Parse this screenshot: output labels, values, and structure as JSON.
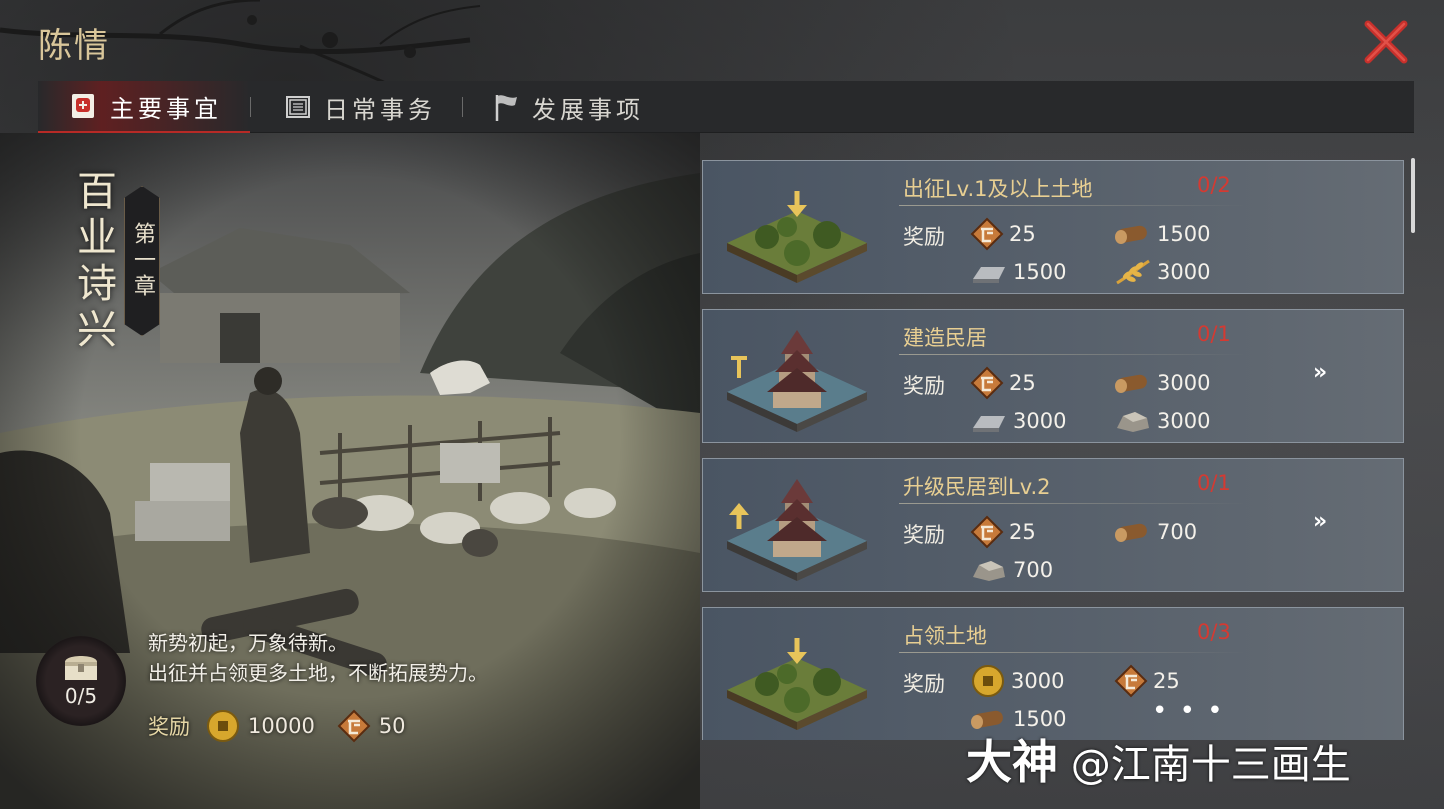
{
  "header": {
    "title": "陈情"
  },
  "tabs": [
    {
      "label": "主要事宜",
      "icon": "scroll-seal-icon",
      "active": true
    },
    {
      "label": "日常事务",
      "icon": "document-icon",
      "active": false
    },
    {
      "label": "发展事项",
      "icon": "flag-icon",
      "active": false
    }
  ],
  "chapter": {
    "name": "百业诗兴",
    "tag": "第一章",
    "chest_progress": "0/5",
    "description": [
      "新势初起，万象待新。",
      "出征并占领更多土地，不断拓展势力。"
    ],
    "reward_label": "奖励",
    "rewards": [
      {
        "icon": "copper-coin-icon",
        "amount": "10000"
      },
      {
        "icon": "fame-token-icon",
        "amount": "50"
      }
    ]
  },
  "tasks": [
    {
      "title": "出征Lv.1及以上土地",
      "progress": "0/2",
      "thumb": "land-tile-icon",
      "reward_label": "奖励",
      "rewards": [
        {
          "icon": "fame-token-icon",
          "amount": "25"
        },
        {
          "icon": "wood-log-icon",
          "amount": "1500"
        },
        {
          "icon": "iron-ingot-icon",
          "amount": "1500"
        },
        {
          "icon": "grain-icon",
          "amount": "3000"
        }
      ],
      "has_more": false
    },
    {
      "title": "建造民居",
      "progress": "0/1",
      "thumb": "residence-build-icon",
      "reward_label": "奖励",
      "rewards": [
        {
          "icon": "fame-token-icon",
          "amount": "25"
        },
        {
          "icon": "wood-log-icon",
          "amount": "3000"
        },
        {
          "icon": "iron-ingot-icon",
          "amount": "3000"
        },
        {
          "icon": "stone-icon",
          "amount": "3000"
        }
      ],
      "has_more": true
    },
    {
      "title": "升级民居到Lv.2",
      "progress": "0/1",
      "thumb": "residence-upgrade-icon",
      "reward_label": "奖励",
      "rewards": [
        {
          "icon": "fame-token-icon",
          "amount": "25"
        },
        {
          "icon": "wood-log-icon",
          "amount": "700"
        },
        {
          "icon": "stone-icon",
          "amount": "700"
        }
      ],
      "has_more": true
    },
    {
      "title": "占领土地",
      "progress": "0/3",
      "thumb": "land-tile-icon",
      "reward_label": "奖励",
      "rewards": [
        {
          "icon": "copper-coin-icon",
          "amount": "3000"
        },
        {
          "icon": "fame-token-icon",
          "amount": "25"
        },
        {
          "icon": "wood-log-icon",
          "amount": "1500"
        }
      ],
      "has_more": false
    }
  ],
  "more_rewards_glyph": "• • •",
  "more_glyph": "»",
  "watermark": {
    "brand": "大神",
    "handle": "@江南十三画生"
  },
  "colors": {
    "accent_red": "#b72a26",
    "progress_red": "#d43a32",
    "gold_text": "#e8cf92"
  }
}
